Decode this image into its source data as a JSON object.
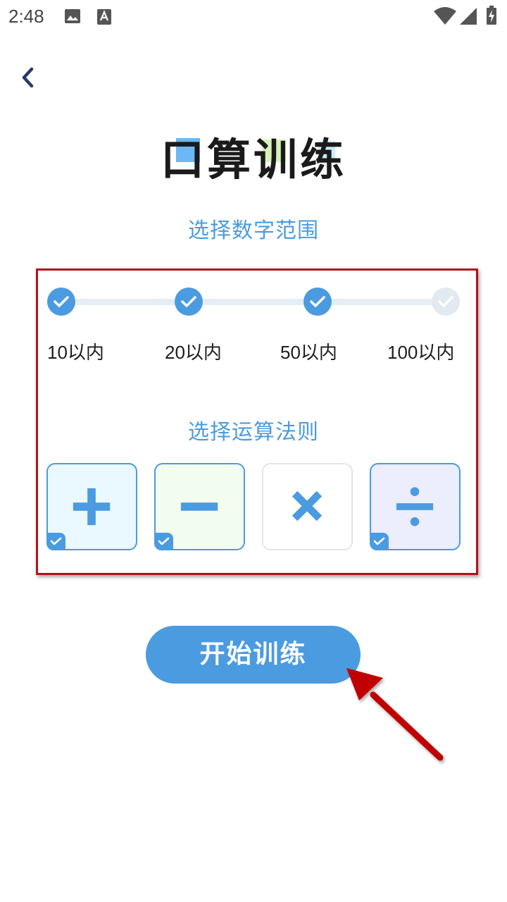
{
  "status_bar": {
    "time": "2:48"
  },
  "title": "口算训练",
  "range_section": {
    "heading": "选择数字范围",
    "options": [
      {
        "label": "10以内",
        "selected": true
      },
      {
        "label": "20以内",
        "selected": true
      },
      {
        "label": "50以内",
        "selected": true
      },
      {
        "label": "100以内",
        "selected": false
      }
    ]
  },
  "operation_section": {
    "heading": "选择运算法则",
    "operations": [
      {
        "symbol": "plus",
        "selected": true,
        "bg": "#eaf8ff"
      },
      {
        "symbol": "minus",
        "selected": true,
        "bg": "#f3fdef"
      },
      {
        "symbol": "multiply",
        "selected": false,
        "bg": "#ffffff"
      },
      {
        "symbol": "divide",
        "selected": true,
        "bg": "#ecedfd"
      }
    ]
  },
  "start_button": {
    "label": "开始训练"
  },
  "colors": {
    "accent": "#4b9be0",
    "highlight": "#b2121b",
    "arrow": "#c00000"
  }
}
